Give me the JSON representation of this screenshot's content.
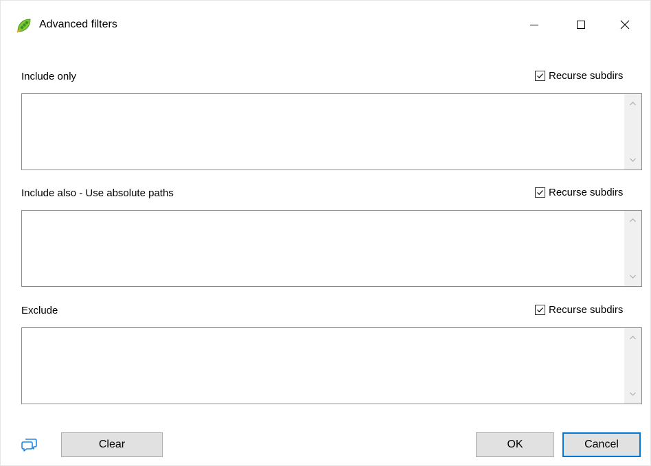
{
  "window": {
    "title": "Advanced filters",
    "icons": {
      "app": "pea-leaf-icon",
      "minimize": "minimize-icon",
      "maximize": "maximize-icon",
      "close": "close-icon"
    }
  },
  "sections": [
    {
      "label": "Include only",
      "recurse_label": "Recurse subdirs",
      "recurse_checked": true,
      "value": ""
    },
    {
      "label": "Include also - Use absolute paths",
      "recurse_label": "Recurse subdirs",
      "recurse_checked": true,
      "value": ""
    },
    {
      "label": "Exclude",
      "recurse_label": "Recurse subdirs",
      "recurse_checked": true,
      "value": ""
    }
  ],
  "footer": {
    "clear_label": "Clear",
    "ok_label": "OK",
    "cancel_label": "Cancel",
    "help_icon": "chat-bubbles-icon"
  },
  "colors": {
    "accent": "#0078d7",
    "icon_green": "#7cc83a",
    "button_bg": "#e1e1e1"
  }
}
